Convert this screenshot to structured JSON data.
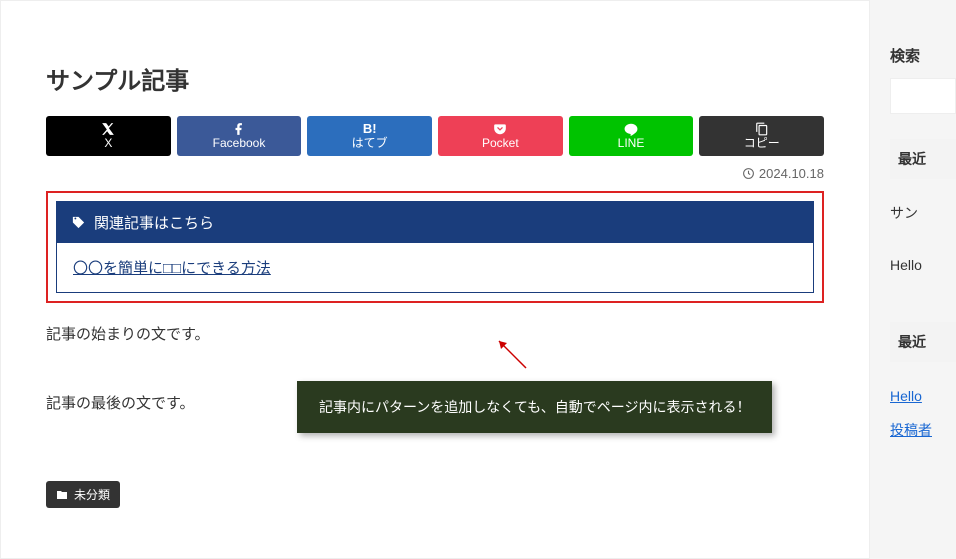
{
  "article": {
    "title": "サンプル記事",
    "date": "2024.10.18",
    "p1": "記事の始まりの文です。",
    "p2": "記事の最後の文です。",
    "category": "未分類"
  },
  "share": {
    "x": "X",
    "facebook": "Facebook",
    "hatena": "はてブ",
    "pocket": "Pocket",
    "line": "LINE",
    "copy": "コピー"
  },
  "related": {
    "heading": "関連記事はこちら",
    "link_text": "〇〇を簡単に□□にできる方法"
  },
  "annotation": {
    "text": "記事内にパターンを追加しなくても、自動でページ内に表示される！"
  },
  "sidebar": {
    "search_label": "検索",
    "recent_heading_1": "最近",
    "item1": "サン",
    "item2": "Hello",
    "recent_heading_2": "最近",
    "link1": "Hello",
    "link2": "投稿者"
  }
}
